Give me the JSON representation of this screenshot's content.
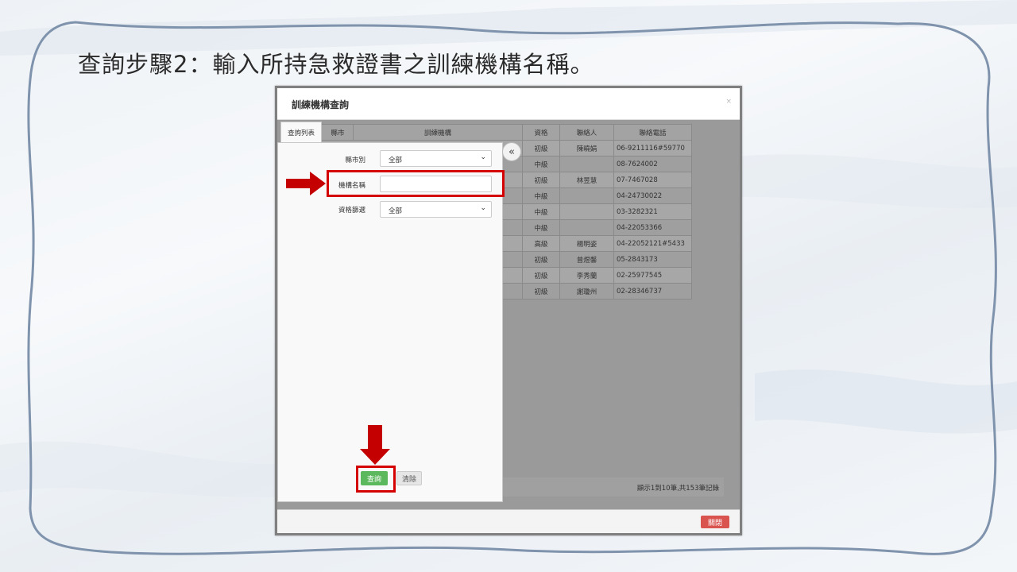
{
  "slide": {
    "title": "查詢步驟2：輸入所持急救證書之訓練機構名稱。"
  },
  "modal": {
    "title": "訓練機構查詢",
    "close_x": "×",
    "close_button": "關閉"
  },
  "tabs": {
    "query_list": "查詢列表",
    "city": "縣市"
  },
  "table": {
    "headers": [
      "訓練機構",
      "資格",
      "聯絡人",
      "聯絡電話"
    ],
    "rows": [
      {
        "level": "初級",
        "contact": "陳曉娟",
        "phone": "06-9211116#59770"
      },
      {
        "level": "中級",
        "contact": "",
        "phone": "08-7624002"
      },
      {
        "level": "初級",
        "contact": "林昱慧",
        "phone": "07-7467028"
      },
      {
        "level": "中級",
        "contact": "",
        "phone": "04-24730022"
      },
      {
        "level": "中級",
        "contact": "",
        "phone": "03-3282321"
      },
      {
        "level": "中級",
        "contact": "",
        "phone": "04-22053366"
      },
      {
        "level": "高級",
        "contact": "楊明姿",
        "phone": "04-22052121#5433"
      },
      {
        "level": "初級",
        "contact": "曾煜馨",
        "phone": "05-2843173"
      },
      {
        "level": "初級",
        "contact": "李秀蘭",
        "phone": "02-25977545"
      },
      {
        "level": "初級",
        "contact": "謝瓊州",
        "phone": "02-28346737"
      }
    ],
    "pager_text": "顯示1到10筆,共153筆記錄"
  },
  "filter_panel": {
    "collapse_icon": "«",
    "city_label": "縣市別",
    "city_value": "全部",
    "name_label": "機構名稱",
    "name_value": "",
    "level_label": "資格篩選",
    "level_value": "全部",
    "query_button": "查詢",
    "clear_button": "清除"
  },
  "colors": {
    "highlight": "#d40000",
    "query_button": "#5cb85c",
    "close_button": "#d9534f"
  }
}
